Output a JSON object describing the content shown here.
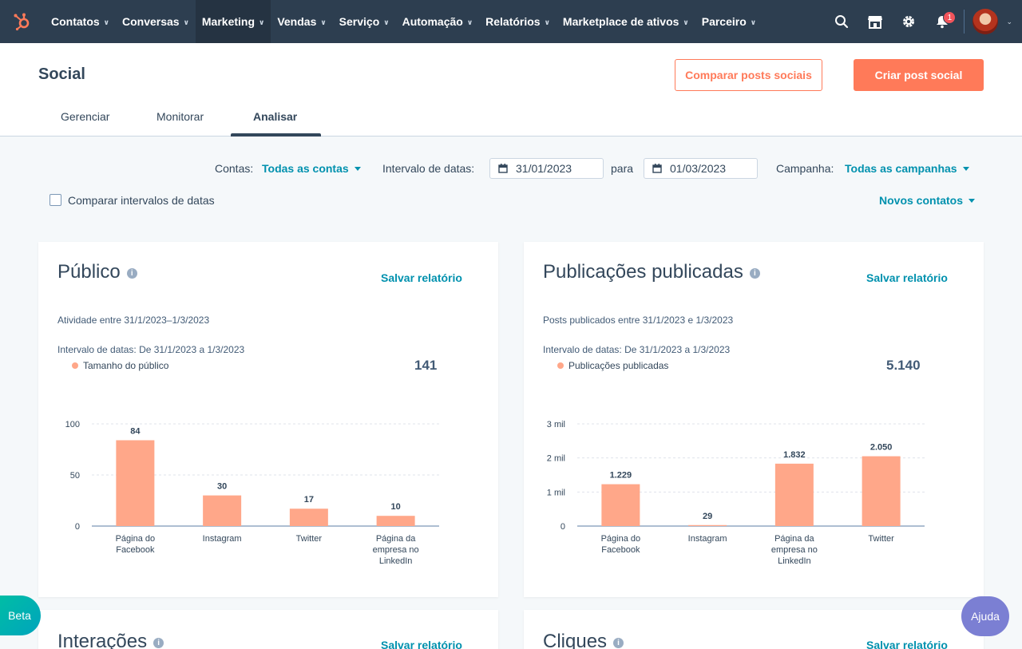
{
  "nav": {
    "items": [
      {
        "label": "Contatos",
        "active": false
      },
      {
        "label": "Conversas",
        "active": false
      },
      {
        "label": "Marketing",
        "active": true
      },
      {
        "label": "Vendas",
        "active": false
      },
      {
        "label": "Serviço",
        "active": false
      },
      {
        "label": "Automação",
        "active": false
      },
      {
        "label": "Relatórios",
        "active": false
      },
      {
        "label": "Marketplace de ativos",
        "active": false
      },
      {
        "label": "Parceiro",
        "active": false
      }
    ],
    "notification_count": "1",
    "colors": {
      "bg": "#2d3e50",
      "active_bg": "#253342",
      "logo": "#ff7a59"
    }
  },
  "header": {
    "title": "Social",
    "compare_button": "Comparar posts sociais",
    "create_button": "Criar post social",
    "tabs": [
      "Gerenciar",
      "Monitorar",
      "Analisar"
    ],
    "active_tab": "Analisar"
  },
  "filters": {
    "accounts_label": "Contas:",
    "accounts_value": "Todas as contas",
    "date_range_label": "Intervalo de datas:",
    "date_from": "31/01/2023",
    "to_label": "para",
    "date_to": "01/03/2023",
    "campaign_label": "Campanha:",
    "campaign_value": "Todas as campanhas",
    "compare_label": "Comparar intervalos de datas",
    "compare_checked": false,
    "metric_value": "Novos contatos"
  },
  "cards": [
    {
      "title": "Público",
      "save": "Salvar relatório",
      "subtitle": "Atividade entre 31/1/2023–1/3/2023",
      "range": "Intervalo de datas: De 31/1/2023 a 1/3/2023",
      "legend": "Tamanho do público",
      "total": "141"
    },
    {
      "title": "Publicações publicadas",
      "save": "Salvar relatório",
      "subtitle": "Posts publicados entre 31/1/2023 e 1/3/2023",
      "range": "Intervalo de datas: De 31/1/2023 a 1/3/2023",
      "legend": "Publicações publicadas",
      "total": "5.140"
    },
    {
      "title": "Interações",
      "save": "Salvar relatório"
    },
    {
      "title": "Cliques",
      "save": "Salvar relatório"
    }
  ],
  "chart_data": [
    {
      "type": "bar",
      "categories": [
        [
          "Página do",
          "Facebook"
        ],
        [
          "Instagram"
        ],
        [
          "Twitter"
        ],
        [
          "Página da",
          "empresa no",
          "LinkedIn"
        ]
      ],
      "series": [
        {
          "name": "Tamanho do público",
          "values": [
            84,
            30,
            17,
            10
          ]
        }
      ],
      "value_labels": [
        "84",
        "30",
        "17",
        "10"
      ],
      "yticks": [
        {
          "v": 0,
          "label": "0"
        },
        {
          "v": 50,
          "label": "50"
        },
        {
          "v": 100,
          "label": "100"
        }
      ],
      "ylim": [
        0,
        100
      ],
      "color": "#ffa789"
    },
    {
      "type": "bar",
      "categories": [
        [
          "Página do",
          "Facebook"
        ],
        [
          "Instagram"
        ],
        [
          "Página da",
          "empresa no",
          "LinkedIn"
        ],
        [
          "Twitter"
        ]
      ],
      "series": [
        {
          "name": "Publicações publicadas",
          "values": [
            1229,
            29,
            1832,
            2050
          ]
        }
      ],
      "value_labels": [
        "1.229",
        "29",
        "1.832",
        "2.050"
      ],
      "yticks": [
        {
          "v": 0,
          "label": "0"
        },
        {
          "v": 1000,
          "label": "1 mil"
        },
        {
          "v": 2000,
          "label": "2 mil"
        },
        {
          "v": 3000,
          "label": "3 mil"
        }
      ],
      "ylim": [
        0,
        3000
      ],
      "color": "#ffa789"
    }
  ],
  "widgets": {
    "beta": "Beta",
    "help": "Ajuda"
  }
}
